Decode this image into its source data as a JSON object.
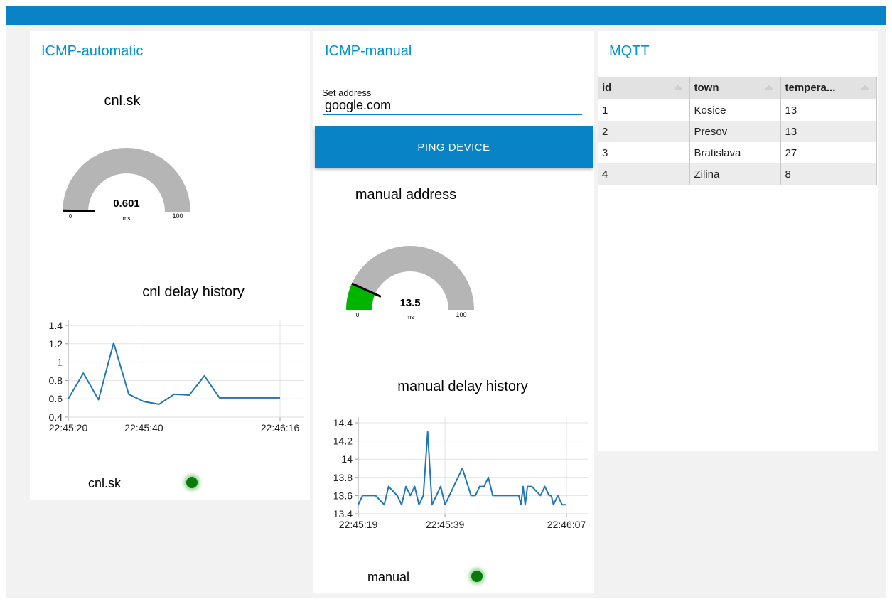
{
  "cards": {
    "auto": {
      "title": "ICMP-automatic",
      "gauge": {
        "label": "cnl.sk",
        "value": 0.601,
        "value_text": "0.601",
        "min": 0,
        "max": 100,
        "unit": "ms",
        "min_text": "0",
        "max_text": "100"
      },
      "chart_title": "cnl delay history",
      "led_label": "cnl.sk"
    },
    "manual": {
      "title": "ICMP-manual",
      "form": {
        "label": "Set address",
        "value": "google.com",
        "button": "PING DEVICE"
      },
      "gauge": {
        "label": "manual address",
        "value": 13.5,
        "value_text": "13.5",
        "min": 0,
        "max": 100,
        "unit": "ms",
        "min_text": "0",
        "max_text": "100"
      },
      "chart_title": "manual delay history",
      "led_label": "manual"
    },
    "mqtt": {
      "title": "MQTT",
      "columns": [
        "id",
        "town",
        "tempera..."
      ],
      "rows": [
        [
          "1",
          "Kosice",
          "13"
        ],
        [
          "2",
          "Presov",
          "13"
        ],
        [
          "3",
          "Bratislava",
          "27"
        ],
        [
          "4",
          "Zilina",
          "8"
        ]
      ]
    }
  },
  "colors": {
    "topbar": "#0883c6",
    "title": "#0094ce",
    "gauge_fill": "#00b500",
    "gauge_bg": "#b5b5b5",
    "line": "#1f77b4",
    "led": "#0a7a0a"
  },
  "chart_data": [
    {
      "type": "line",
      "title": "cnl delay history",
      "x": [
        "22:45:20",
        "22:45:24",
        "22:45:28",
        "22:45:32",
        "22:45:36",
        "22:45:40",
        "22:45:44",
        "22:45:48",
        "22:45:52",
        "22:45:56",
        "22:46:00",
        "22:46:04",
        "22:46:08",
        "22:46:16"
      ],
      "x_seconds": [
        0,
        4,
        8,
        12,
        16,
        20,
        24,
        28,
        32,
        36,
        40,
        44,
        48,
        56
      ],
      "values": [
        0.6,
        0.88,
        0.59,
        1.21,
        0.65,
        0.57,
        0.54,
        0.65,
        0.64,
        0.85,
        0.61,
        0.61,
        0.61,
        0.61
      ],
      "xticks": [
        "22:45:20",
        "22:45:40",
        "22:46:16"
      ],
      "xtick_seconds": [
        0,
        20,
        56
      ],
      "yticks": [
        "0.4",
        "0.6",
        "0.8",
        "1",
        "1.2",
        "1.4"
      ],
      "ylim": [
        0.4,
        1.4
      ],
      "xlim_seconds": [
        0,
        56
      ],
      "grid": true
    },
    {
      "type": "line",
      "title": "manual delay history",
      "x_seconds": [
        0,
        1,
        2,
        4,
        6,
        7,
        9,
        10,
        11,
        12,
        13,
        14,
        15,
        16,
        17,
        18,
        19,
        20,
        21,
        22,
        24,
        26,
        27,
        28,
        29,
        30,
        31,
        32,
        33,
        35,
        36,
        37,
        37.5,
        38,
        38.5,
        39,
        40,
        42,
        43,
        44,
        44.5,
        45,
        46,
        47,
        48
      ],
      "values": [
        13.5,
        13.6,
        13.6,
        13.6,
        13.5,
        13.7,
        13.6,
        13.5,
        13.7,
        13.6,
        13.7,
        13.5,
        13.6,
        14.3,
        13.5,
        13.6,
        13.7,
        13.5,
        13.6,
        13.7,
        13.9,
        13.6,
        13.6,
        13.7,
        13.7,
        13.8,
        13.6,
        13.6,
        13.6,
        13.6,
        13.6,
        13.6,
        13.5,
        13.7,
        13.5,
        13.7,
        13.7,
        13.6,
        13.7,
        13.6,
        13.6,
        13.5,
        13.6,
        13.5,
        13.5
      ],
      "xticks": [
        "22:45:19",
        "22:45:39",
        "22:46:07"
      ],
      "xtick_seconds": [
        0,
        20,
        48
      ],
      "yticks": [
        "13.4",
        "13.6",
        "13.8",
        "14",
        "14.2",
        "14.4"
      ],
      "ylim": [
        13.4,
        14.4
      ],
      "xlim_seconds": [
        0,
        48
      ],
      "grid": true
    }
  ]
}
